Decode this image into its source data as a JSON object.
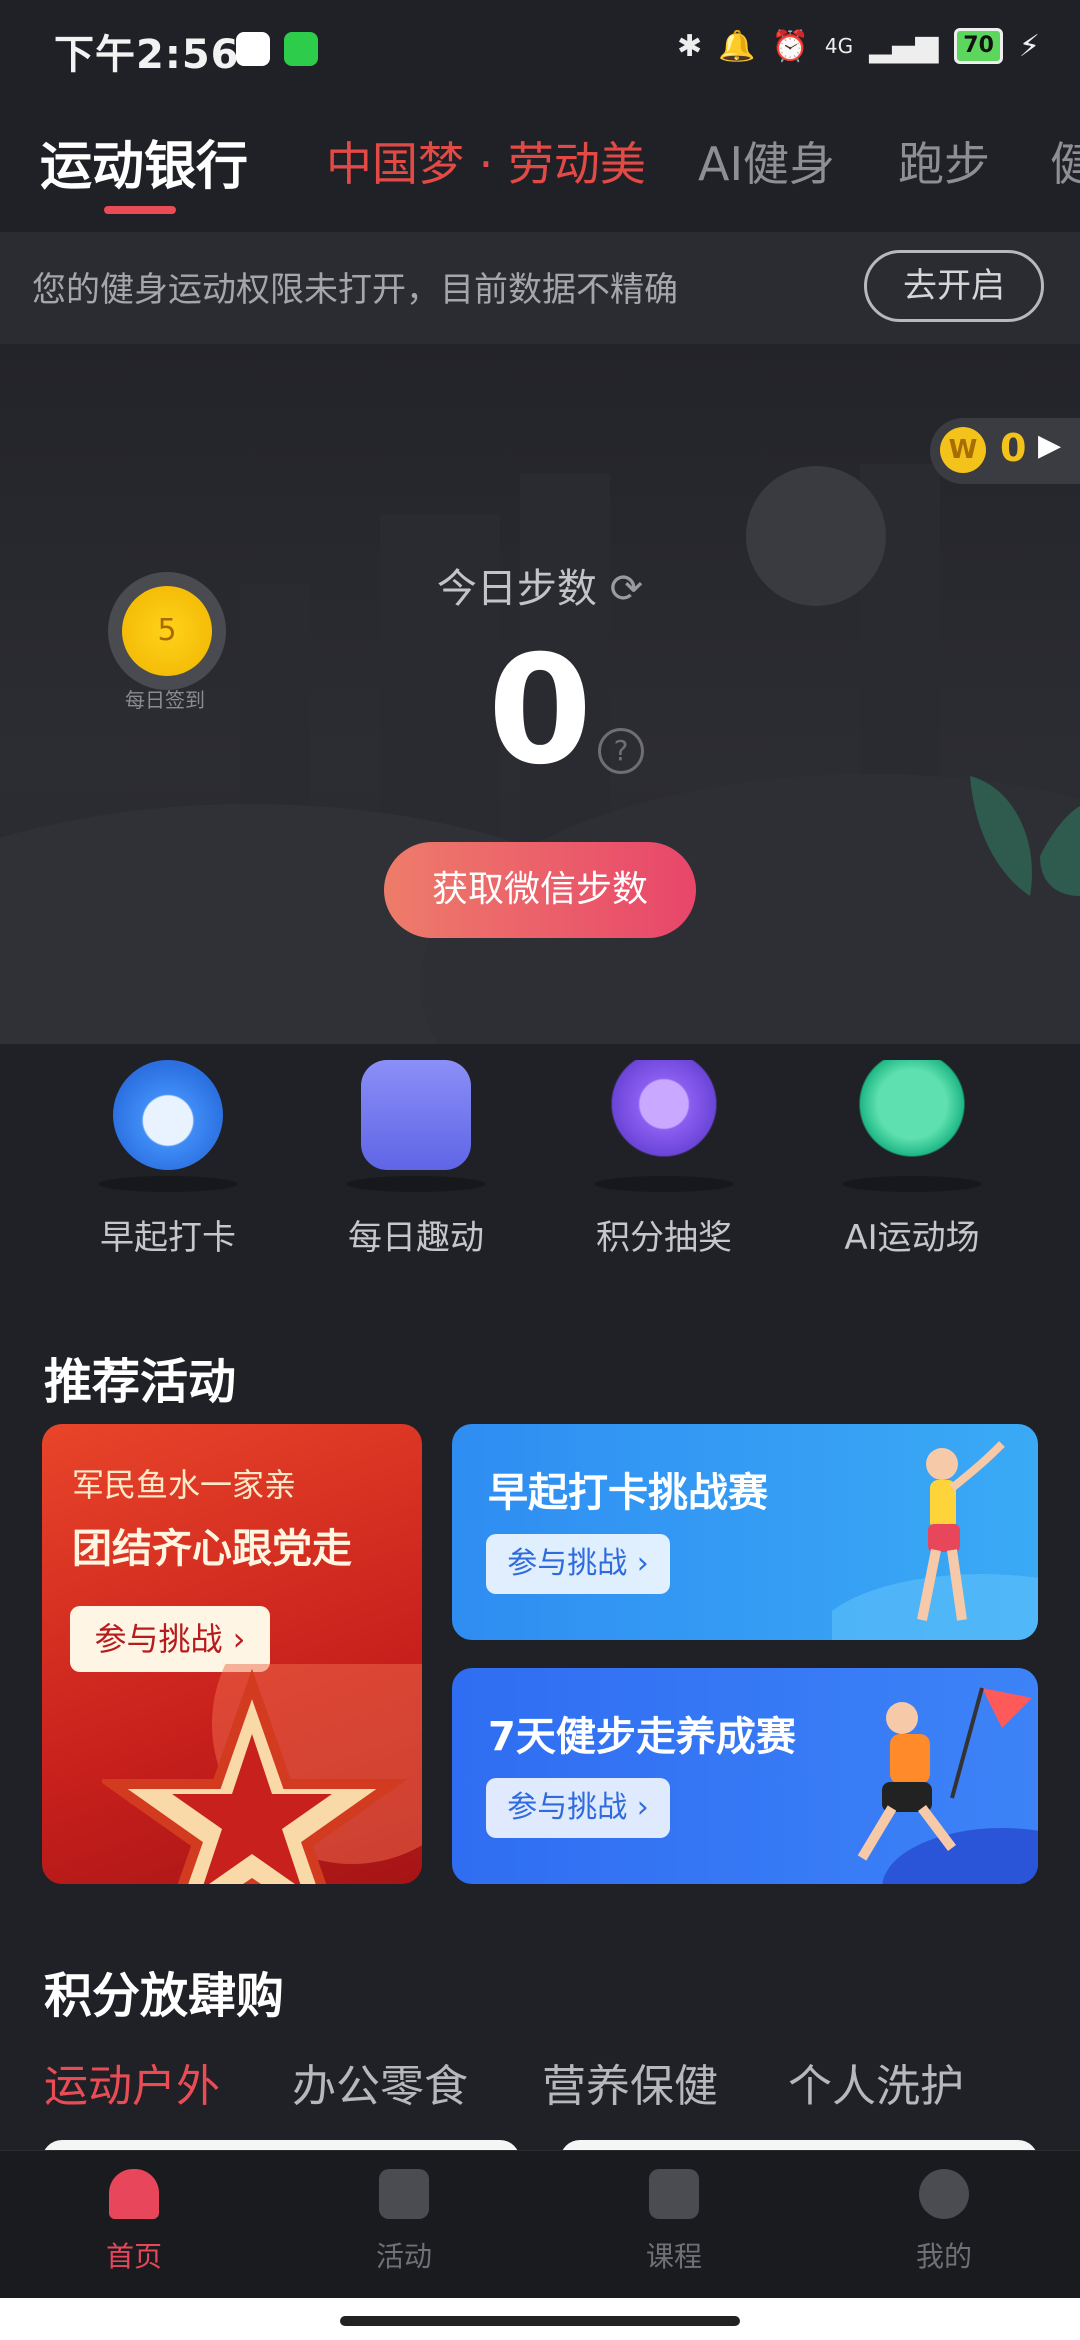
{
  "status_bar": {
    "time": "下午2:56",
    "battery": "70",
    "network": "4G"
  },
  "top_tabs": [
    "运动银行",
    "中国梦 · 劳动美",
    "AI健身",
    "跑步",
    "健"
  ],
  "notice": {
    "text": "您的健身运动权限未打开，目前数据不精确",
    "button": "去开启"
  },
  "coins": {
    "value": "0"
  },
  "daily_sign": {
    "number": "5",
    "label": "每日签到"
  },
  "steps": {
    "title": "今日步数",
    "value": "0",
    "help": "?",
    "button": "获取微信步数"
  },
  "features": [
    {
      "label": "早起打卡",
      "icon": "alarm-clock-icon"
    },
    {
      "label": "每日趣动",
      "icon": "clipboard-icon"
    },
    {
      "label": "积分抽奖",
      "icon": "lottery-icon"
    },
    {
      "label": "AI运动场",
      "icon": "runner-icon"
    }
  ],
  "recommend": {
    "title": "推荐活动",
    "card_main": {
      "line1": "军民鱼水一家亲",
      "line2": "团结齐心跟党走",
      "button": "参与挑战 ›"
    },
    "card_a": {
      "title": "早起打卡挑战赛",
      "button": "参与挑战 ›"
    },
    "card_b": {
      "title": "7天健步走养成赛",
      "button": "参与挑战 ›"
    }
  },
  "points_mall": {
    "title": "积分放肆购",
    "tabs": [
      "运动户外",
      "办公零食",
      "营养保健",
      "个人洗护"
    ]
  },
  "bottom_nav": [
    "首页",
    "活动",
    "课程",
    "我的"
  ],
  "colors": {
    "accent": "#e8465a",
    "coin": "#f3c31b",
    "background": "#202126"
  }
}
